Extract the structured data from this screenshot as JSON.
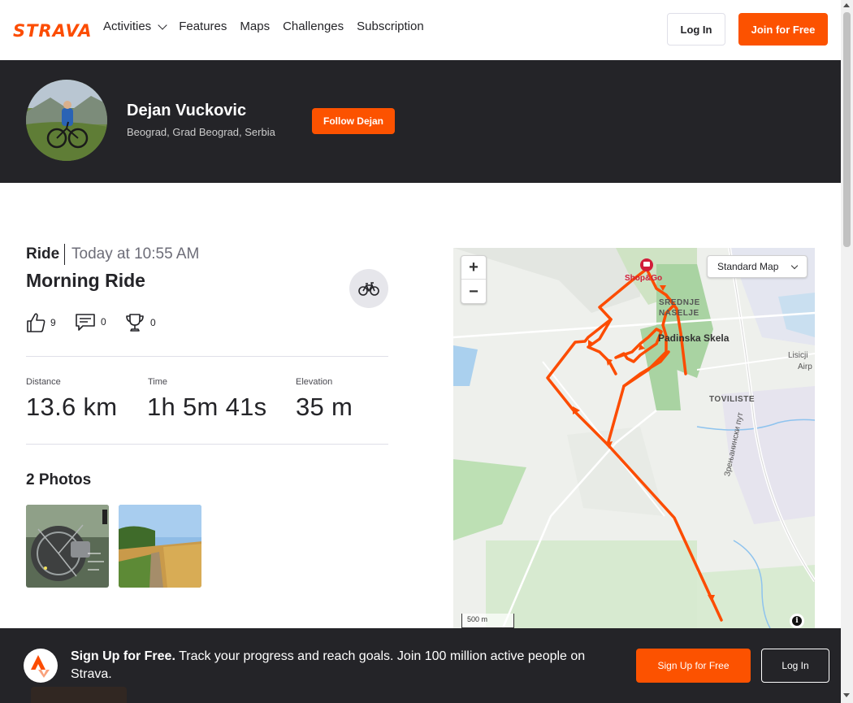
{
  "header": {
    "logo": "STRAVA",
    "nav": [
      "Activities",
      "Features",
      "Maps",
      "Challenges",
      "Subscription"
    ],
    "login_label": "Log In",
    "join_label": "Join for Free"
  },
  "athlete": {
    "name": "Dejan Vuckovic",
    "location": "Beograd, Grad Beograd, Serbia",
    "follow_label": "Follow Dejan"
  },
  "activity": {
    "type": "Ride",
    "time": "Today at 10:55 AM",
    "title": "Morning Ride",
    "kudos": "9",
    "comments": "0",
    "achievements": "0",
    "stats": [
      {
        "label": "Distance",
        "value": "13.6 km"
      },
      {
        "label": "Time",
        "value": "1h 5m 41s"
      },
      {
        "label": "Elevation",
        "value": "35 m"
      }
    ],
    "photos_heading": "2 Photos"
  },
  "map": {
    "style_label": "Standard Map",
    "scale_label": "500 m",
    "labels": {
      "shop": "Shop&Go",
      "srednje1": "SREDNJE",
      "srednje2": "NASELJE",
      "padinska": "Padinska Skela",
      "toviliste": "TOVILISTE",
      "road": "Зрењанински пут",
      "lisicji": "Lisicji",
      "airp": "Airp"
    },
    "route_color": "#fc4c02"
  },
  "footer": {
    "headline": "Sign Up for Free.",
    "text": "Track your progress and reach goals. Join 100 million active people on Strava.",
    "signup_label": "Sign Up for Free",
    "login_label": "Log In"
  }
}
